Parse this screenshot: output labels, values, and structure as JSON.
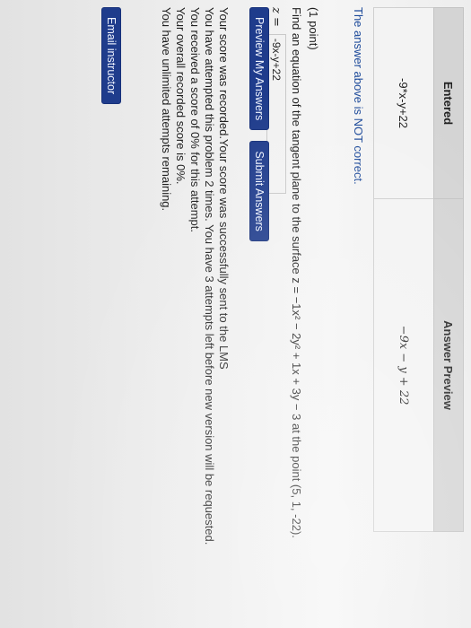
{
  "results_table": {
    "headers": [
      "Entered",
      "Answer Preview"
    ],
    "entered": "-9*x-y+22",
    "preview": "−9x − y + 22"
  },
  "status_message": "The answer above is NOT correct.",
  "problem": {
    "points": "(1 point)",
    "statement": "Find an equation of the tangent plane to the surface z = −1x² − 2y² + 1x + 3y − 3 at the point (5, 1, -22).",
    "answer_label": "z =",
    "answer_value": "-9x-y+22"
  },
  "buttons": {
    "preview": "Preview My Answers",
    "submit": "Submit Answers",
    "email": "Email instructor"
  },
  "feedback": [
    "Your score was recorded.Your score was successfully sent to the LMS",
    "You have attempted this problem 2 times. You have 3 attempts left before new version will be requested.",
    "You received a score of 0% for this attempt.",
    "Your overall recorded score is 0%.",
    "You have unlimited attempts remaining."
  ]
}
